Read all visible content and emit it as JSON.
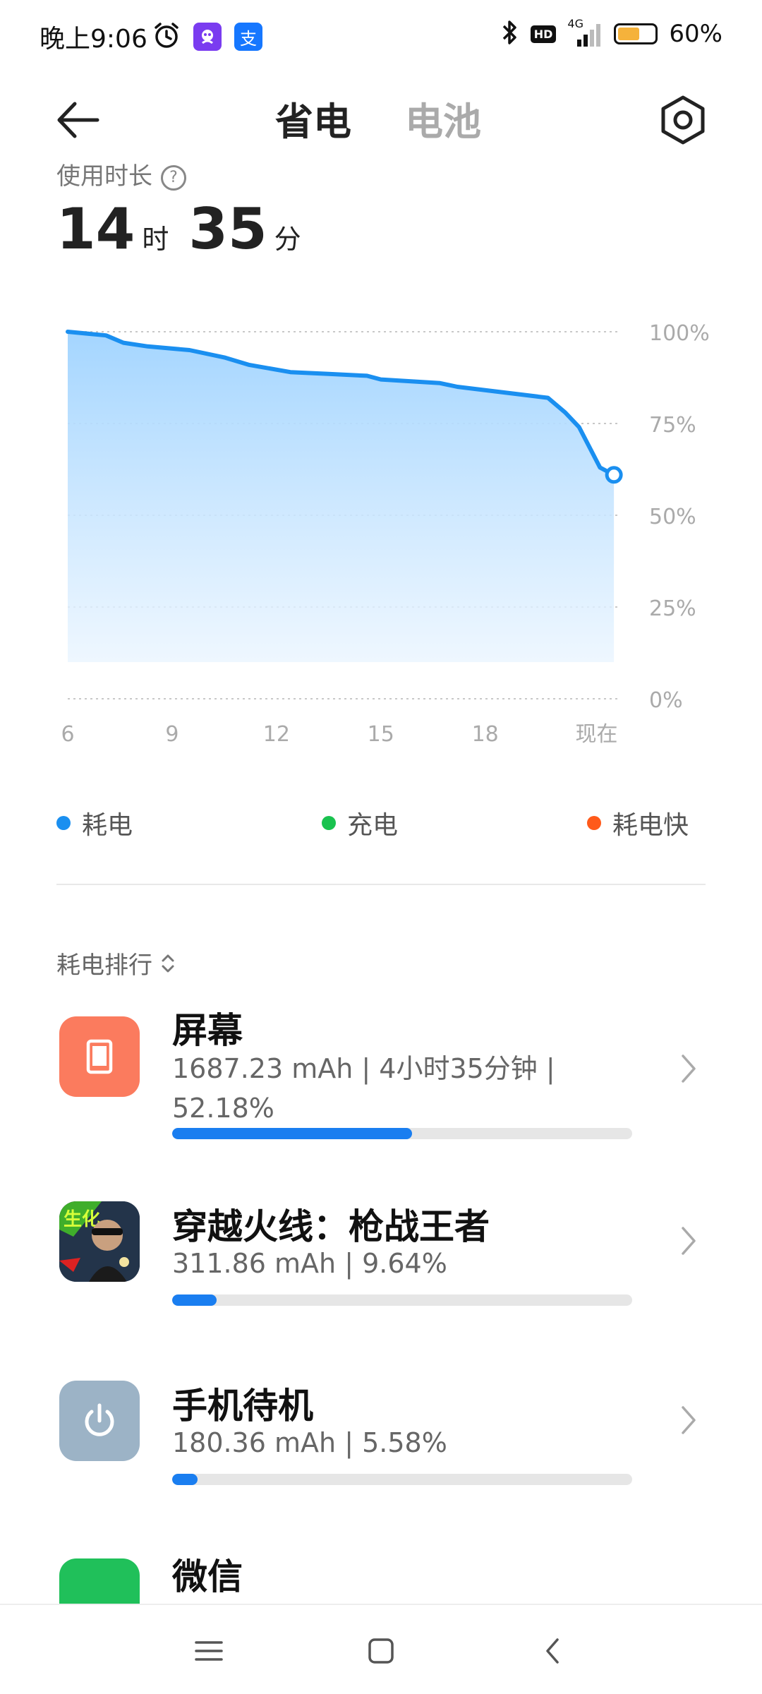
{
  "status_bar": {
    "time": "晚上9:06",
    "network": "4G",
    "hd_label": "HD",
    "battery_percent": "60%",
    "battery_level": 0.6,
    "apps": [
      {
        "icon": "alarm-icon"
      },
      {
        "icon": "app-notification-icon",
        "color": "#7a3cf0"
      },
      {
        "icon": "alipay-icon",
        "color": "#1677ff",
        "glyph": "支"
      }
    ]
  },
  "header": {
    "tabs": [
      {
        "label": "省电",
        "active": true
      },
      {
        "label": "电池",
        "active": false
      }
    ]
  },
  "usage": {
    "label": "使用时长",
    "hours": "14",
    "hours_unit": "时",
    "minutes": "35",
    "minutes_unit": "分"
  },
  "chart_data": {
    "type": "area",
    "x_ticks": [
      "6",
      "9",
      "12",
      "15",
      "18",
      "现在"
    ],
    "y_ticks": [
      "100%",
      "75%",
      "50%",
      "25%",
      "0%"
    ],
    "ylim": [
      0,
      100
    ],
    "xlim": [
      6,
      21.9
    ],
    "x": [
      6,
      7.1,
      7.6,
      8.3,
      9.5,
      10.5,
      11.2,
      12.4,
      13.5,
      14.6,
      15,
      16.7,
      17.2,
      19.8,
      20.3,
      20.7,
      21.3,
      21.7
    ],
    "values": [
      100,
      99,
      97,
      96,
      95,
      93,
      91,
      89,
      88.5,
      88,
      87,
      86,
      85,
      82,
      78,
      74,
      63,
      61
    ],
    "series_color": "#1a8ff0",
    "grid": true
  },
  "legend": [
    {
      "label": "耗电",
      "color": "#1a8ff0"
    },
    {
      "label": "充电",
      "color": "#19c24f"
    },
    {
      "label": "耗电快",
      "color": "#ff5a1a"
    }
  ],
  "ranking": {
    "title": "耗电排行"
  },
  "apps": [
    {
      "name": "屏幕",
      "stats": "1687.23 mAh | 4小时35分钟 | 52.18%",
      "percent": 52.18,
      "icon": "screen-icon",
      "icon_bg": "#fb7b5e"
    },
    {
      "name": "穿越火线：枪战王者",
      "stats": "311.86 mAh | 9.64%",
      "percent": 9.64,
      "icon": "game-icon",
      "icon_bg": "#2a3b52"
    },
    {
      "name": "手机待机",
      "stats": "180.36 mAh | 5.58%",
      "percent": 5.58,
      "icon": "power-icon",
      "icon_bg": "#9cb3c6"
    },
    {
      "name": "微信",
      "icon": "wechat-icon",
      "icon_bg": "#20c05a"
    }
  ]
}
